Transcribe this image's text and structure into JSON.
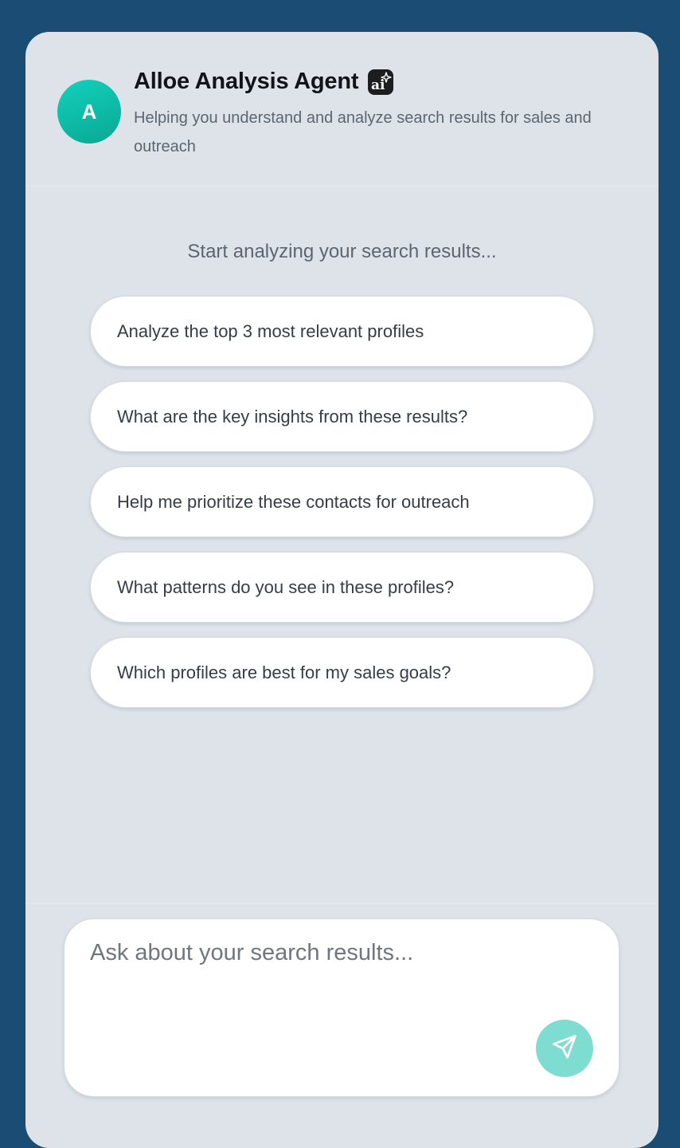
{
  "agent": {
    "avatar_letter": "A",
    "title": "Alloe Analysis Agent",
    "ai_badge_icon": "ai-sparkle-icon",
    "description": "Helping you understand and analyze search results for sales and outreach"
  },
  "intro": {
    "heading": "Start analyzing your search results..."
  },
  "suggestions": [
    {
      "label": "Analyze the top 3 most relevant profiles"
    },
    {
      "label": "What are the key insights from these results?"
    },
    {
      "label": "Help me prioritize these contacts for outreach"
    },
    {
      "label": "What patterns do you see in these profiles?"
    },
    {
      "label": "Which profiles are best for my sales goals?"
    }
  ],
  "composer": {
    "placeholder": "Ask about your search results...",
    "value": "",
    "send_icon": "paper-plane-icon"
  },
  "colors": {
    "page_background": "#1a4c74",
    "panel_background": "#dde3e9",
    "avatar_gradient_start": "#12d1bd",
    "avatar_gradient_end": "#0aa892",
    "send_button": "#7fdcd1"
  }
}
